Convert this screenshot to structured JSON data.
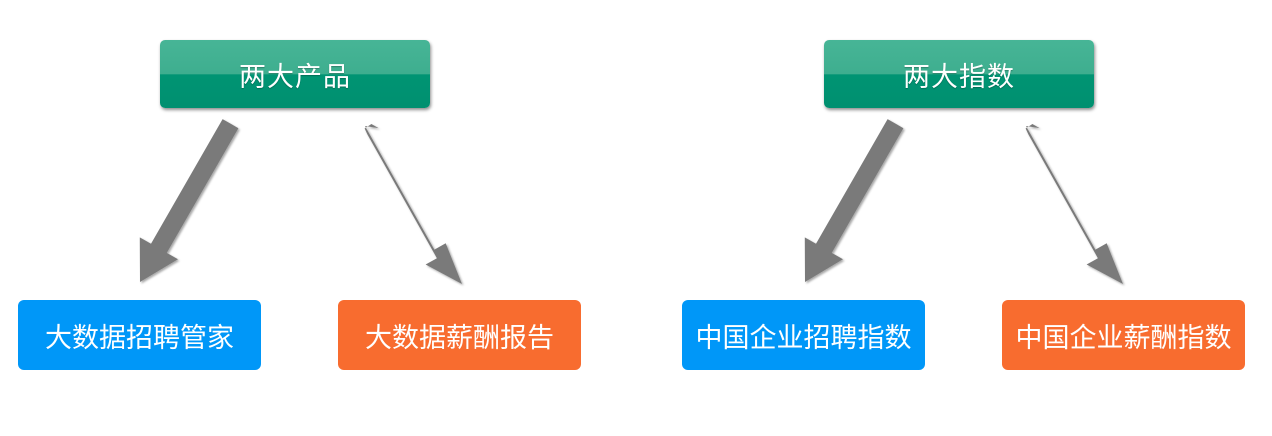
{
  "left_group": {
    "title": "两大产品",
    "children": [
      {
        "label": "大数据招聘管家"
      },
      {
        "label": "大数据薪酬报告"
      }
    ]
  },
  "right_group": {
    "title": "两大指数",
    "children": [
      {
        "label": "中国企业招聘指数"
      },
      {
        "label": "中国企业薪酬指数"
      }
    ]
  },
  "colors": {
    "parent_green": "#009473",
    "child_blue": "#0097f8",
    "child_orange": "#f86c2f",
    "arrow_gray": "#7a7a7a"
  }
}
